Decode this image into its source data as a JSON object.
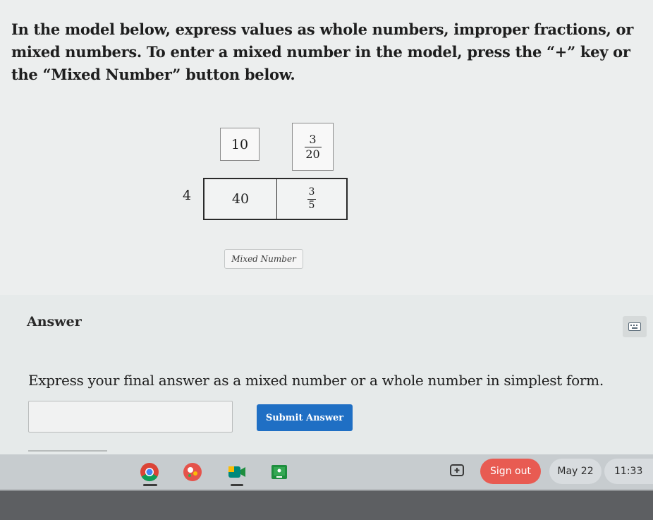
{
  "instructions": "In the model below, express values as whole numbers, improper fractions, or mixed numbers. To enter a mixed number in the model, press the “+” key or the “Mixed Number” button below.",
  "model": {
    "top_whole": "10",
    "top_fraction": {
      "numerator": "3",
      "denominator": "20"
    },
    "side_whole": "4",
    "cell_whole": "40",
    "cell_fraction": {
      "numerator": "3",
      "denominator": "5"
    }
  },
  "mixed_number_button": "Mixed Number",
  "answer": {
    "label": "Answer",
    "prompt": "Express your final answer as a mixed number or a whole number in simplest form.",
    "input_value": "",
    "submit_label": "Submit Answer"
  },
  "taskbar": {
    "apps": [
      "chrome-icon",
      "assistant-icon",
      "meet-icon",
      "classroom-icon"
    ],
    "screenshot_icon": "screenshot-icon",
    "sign_out": "Sign out",
    "date": "May 22",
    "time": "11:33"
  },
  "colors": {
    "accent": "#1f6fc4",
    "sign_out": "#e85b52"
  }
}
